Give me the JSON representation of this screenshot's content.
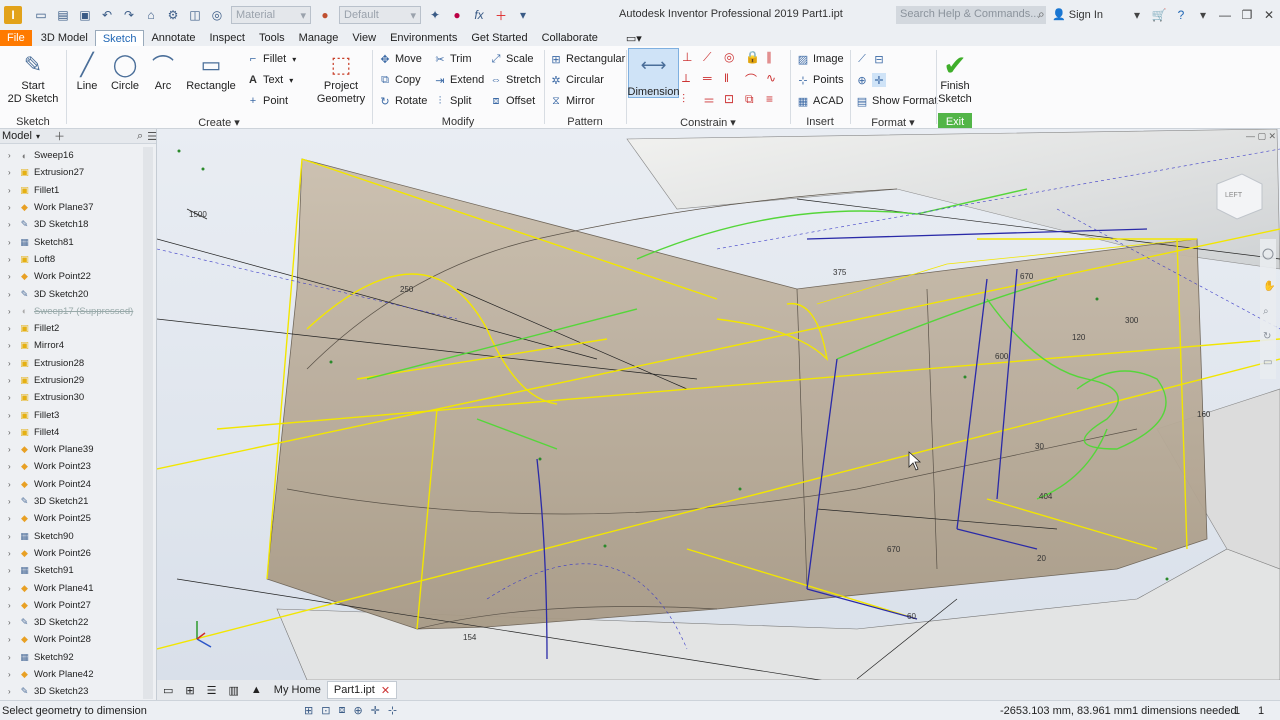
{
  "title_bar": {
    "material_combo": "Material",
    "appearance_combo": "Default",
    "window_title": "Autodesk Inventor Professional 2019   Part1.ipt",
    "search_placeholder": "Search Help & Commands...",
    "sign_in": "Sign In"
  },
  "menu_tabs": [
    "File",
    "3D Model",
    "Sketch",
    "Annotate",
    "Inspect",
    "Tools",
    "Manage",
    "View",
    "Environments",
    "Get Started",
    "Collaborate"
  ],
  "active_tab": "Sketch",
  "ribbon": {
    "sketch_panel": {
      "start_sketch": "Start\n2D Sketch",
      "title": "Sketch"
    },
    "create_panel": {
      "line": "Line",
      "circle": "Circle",
      "arc": "Arc",
      "rectangle": "Rectangle",
      "fillet": "Fillet",
      "text": "Text",
      "point": "Point",
      "project_geometry": "Project\nGeometry",
      "title": "Create"
    },
    "modify_panel": {
      "move": "Move",
      "trim": "Trim",
      "scale": "Scale",
      "copy": "Copy",
      "extend": "Extend",
      "stretch": "Stretch",
      "rotate": "Rotate",
      "split": "Split",
      "offset": "Offset",
      "title": "Modify"
    },
    "pattern_panel": {
      "rectangular": "Rectangular",
      "circular": "Circular",
      "mirror": "Mirror",
      "title": "Pattern"
    },
    "constrain_panel": {
      "dimension": "Dimension",
      "title": "Constrain"
    },
    "insert_panel": {
      "image": "Image",
      "points": "Points",
      "acad": "ACAD",
      "title": "Insert"
    },
    "format_panel": {
      "show_format": "Show Format",
      "title": "Format"
    },
    "exit_panel": {
      "finish_sketch": "Finish\nSketch",
      "title": "Exit"
    }
  },
  "browser": {
    "header": "Model",
    "items": [
      {
        "label": "Sweep16",
        "icon": "sweep-icon",
        "color": "#777777",
        "suppressed": false
      },
      {
        "label": "Extrusion27",
        "icon": "extrusion-icon",
        "color": "#e5b012",
        "suppressed": false
      },
      {
        "label": "Fillet1",
        "icon": "fillet-icon",
        "color": "#e5b012",
        "suppressed": false
      },
      {
        "label": "Work Plane37",
        "icon": "work-plane-icon",
        "color": "#e8a024",
        "suppressed": false
      },
      {
        "label": "3D Sketch18",
        "icon": "3d-sketch-icon",
        "color": "#4e6e9a",
        "suppressed": false
      },
      {
        "label": "Sketch81",
        "icon": "sketch-icon",
        "color": "#4e6e9a",
        "suppressed": false
      },
      {
        "label": "Loft8",
        "icon": "loft-icon",
        "color": "#e5b012",
        "suppressed": false
      },
      {
        "label": "Work Point22",
        "icon": "work-point-icon",
        "color": "#e8a024",
        "suppressed": false
      },
      {
        "label": "3D Sketch20",
        "icon": "3d-sketch-icon",
        "color": "#4e6e9a",
        "suppressed": false
      },
      {
        "label": "Sweep17 (Suppressed)",
        "icon": "sweep-icon",
        "color": "#aaaaaa",
        "suppressed": true
      },
      {
        "label": "Fillet2",
        "icon": "fillet-icon",
        "color": "#e5b012",
        "suppressed": false
      },
      {
        "label": "Mirror4",
        "icon": "mirror-icon",
        "color": "#e5b012",
        "suppressed": false
      },
      {
        "label": "Extrusion28",
        "icon": "extrusion-icon",
        "color": "#e5b012",
        "suppressed": false
      },
      {
        "label": "Extrusion29",
        "icon": "extrusion-icon",
        "color": "#e5b012",
        "suppressed": false
      },
      {
        "label": "Extrusion30",
        "icon": "extrusion-icon",
        "color": "#e5b012",
        "suppressed": false
      },
      {
        "label": "Fillet3",
        "icon": "fillet-icon",
        "color": "#e5b012",
        "suppressed": false
      },
      {
        "label": "Fillet4",
        "icon": "fillet-icon",
        "color": "#e5b012",
        "suppressed": false
      },
      {
        "label": "Work Plane39",
        "icon": "work-plane-icon",
        "color": "#e8a024",
        "suppressed": false
      },
      {
        "label": "Work Point23",
        "icon": "work-point-icon",
        "color": "#e8a024",
        "suppressed": false
      },
      {
        "label": "Work Point24",
        "icon": "work-point-icon",
        "color": "#e8a024",
        "suppressed": false
      },
      {
        "label": "3D Sketch21",
        "icon": "3d-sketch-icon",
        "color": "#4e6e9a",
        "suppressed": false
      },
      {
        "label": "Work Point25",
        "icon": "work-point-icon",
        "color": "#e8a024",
        "suppressed": false
      },
      {
        "label": "Sketch90",
        "icon": "sketch-icon",
        "color": "#4e6e9a",
        "suppressed": false
      },
      {
        "label": "Work Point26",
        "icon": "work-point-icon",
        "color": "#e8a024",
        "suppressed": false
      },
      {
        "label": "Sketch91",
        "icon": "sketch-icon",
        "color": "#4e6e9a",
        "suppressed": false
      },
      {
        "label": "Work Plane41",
        "icon": "work-plane-icon",
        "color": "#e8a024",
        "suppressed": false
      },
      {
        "label": "Work Point27",
        "icon": "work-point-icon",
        "color": "#e8a024",
        "suppressed": false
      },
      {
        "label": "3D Sketch22",
        "icon": "3d-sketch-icon",
        "color": "#4e6e9a",
        "suppressed": false
      },
      {
        "label": "Work Point28",
        "icon": "work-point-icon",
        "color": "#e8a024",
        "suppressed": false
      },
      {
        "label": "Sketch92",
        "icon": "sketch-icon",
        "color": "#4e6e9a",
        "suppressed": false
      },
      {
        "label": "Work Plane42",
        "icon": "work-plane-icon",
        "color": "#e8a024",
        "suppressed": false
      },
      {
        "label": "3D Sketch23",
        "icon": "3d-sketch-icon",
        "color": "#4e6e9a",
        "suppressed": false
      }
    ]
  },
  "viewport": {
    "dimensions": [
      "1500",
      "250",
      "375",
      "670",
      "300",
      "120",
      "160",
      "30",
      "404",
      "20",
      "670",
      "154",
      "60",
      "600"
    ],
    "viewcube_label": "LEFT"
  },
  "doc_tabs": {
    "home": "My Home",
    "file": "Part1.ipt"
  },
  "status": {
    "message": "Select geometry to dimension",
    "coords": "-2653.103 mm, 83.961 mm",
    "dims_needed": "1 dimensions needed",
    "count1": "1",
    "count2": "1"
  },
  "colors": {
    "file_tab": "#ff7a00",
    "sketch_yellow": "#f2e600",
    "sketch_green": "#55d63a",
    "constraint_blue": "#2a2aa8",
    "exit_green": "#53b548"
  }
}
